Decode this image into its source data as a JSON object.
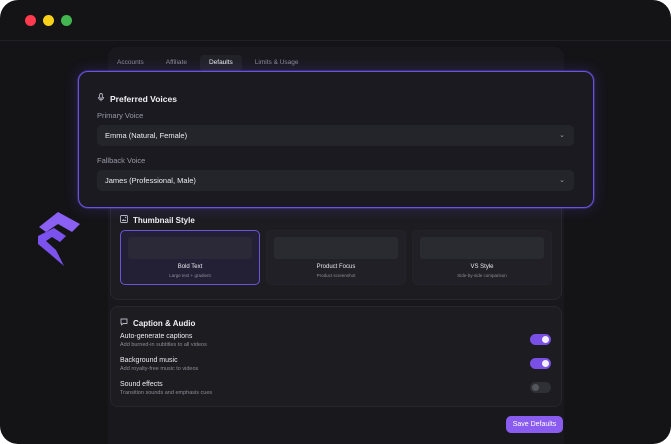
{
  "tabs": [
    {
      "label": "Accounts"
    },
    {
      "label": "Affiliate"
    },
    {
      "label": "Defaults"
    },
    {
      "label": "Limits & Usage"
    }
  ],
  "voices": {
    "title": "Preferred Voices",
    "icon": "microphone-icon",
    "primary_label": "Primary Voice",
    "primary_value": "Emma (Natural, Female)",
    "fallback_label": "Fallback Voice",
    "fallback_value": "James (Professional, Male)"
  },
  "thumbnail": {
    "title": "Thumbnail Style",
    "icon": "image-icon",
    "options": [
      {
        "name": "Bold Text",
        "desc": "Large text + gradient"
      },
      {
        "name": "Product Focus",
        "desc": "Product screenshot"
      },
      {
        "name": "VS Style",
        "desc": "Side-by-side comparison"
      }
    ]
  },
  "captions": {
    "title": "Caption & Audio",
    "icon": "chat-bubble-icon",
    "rows": [
      {
        "title": "Auto-generate captions",
        "desc": "Add burned-in subtitles to all videos",
        "enabled": true
      },
      {
        "title": "Background music",
        "desc": "Add royalty-free music to videos",
        "enabled": true
      },
      {
        "title": "Sound effects",
        "desc": "Transition sounds and emphasis cues",
        "enabled": false
      }
    ]
  },
  "save_label": "Save Defaults",
  "colors": {
    "accent": "#8a5cf0",
    "highlight_border": "#6b52e0",
    "background": "#141417"
  }
}
